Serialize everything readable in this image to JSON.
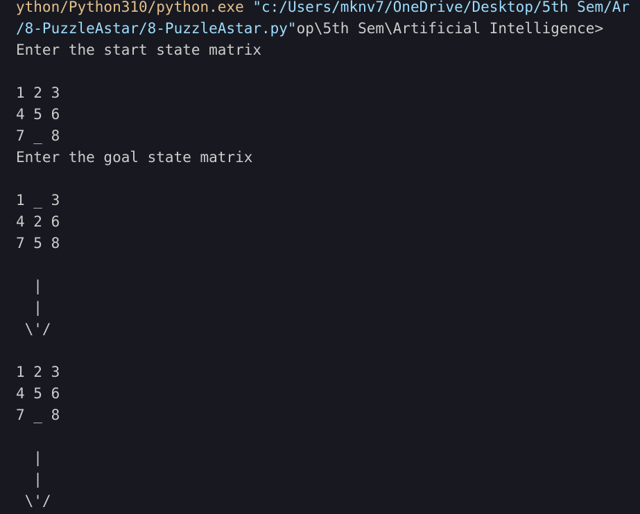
{
  "colors": {
    "background": "#181920",
    "text": "#cccccc",
    "exe_path": "#e2c08d",
    "string_arg": "#9cdcfe"
  },
  "terminal": {
    "cmd_line_1": {
      "exe": "ython/Python310/python.exe",
      "arg": " \"c:/Users/mknv7/OneDrive/Desktop/5th Sem/Ar"
    },
    "cmd_line_2": {
      "arg": "/8-PuzzleAstar/8-PuzzleAstar.py\"",
      "rest": "op\\5th Sem\\Artificial Intelligence>"
    },
    "prompt_start": "Enter the start state matrix",
    "start_matrix": [
      "1 2 3",
      "4 5 6",
      "7 _ 8"
    ],
    "prompt_goal": "Enter the goal state matrix",
    "goal_matrix": [
      "1 _ 3",
      "4 2 6",
      "7 5 8"
    ],
    "arrow": [
      "  |",
      "  |",
      " \\'/"
    ],
    "step_matrix": [
      "1 2 3",
      "4 5 6",
      "7 _ 8"
    ],
    "arrow_2": [
      "  |",
      "  |",
      " \\'/"
    ]
  }
}
